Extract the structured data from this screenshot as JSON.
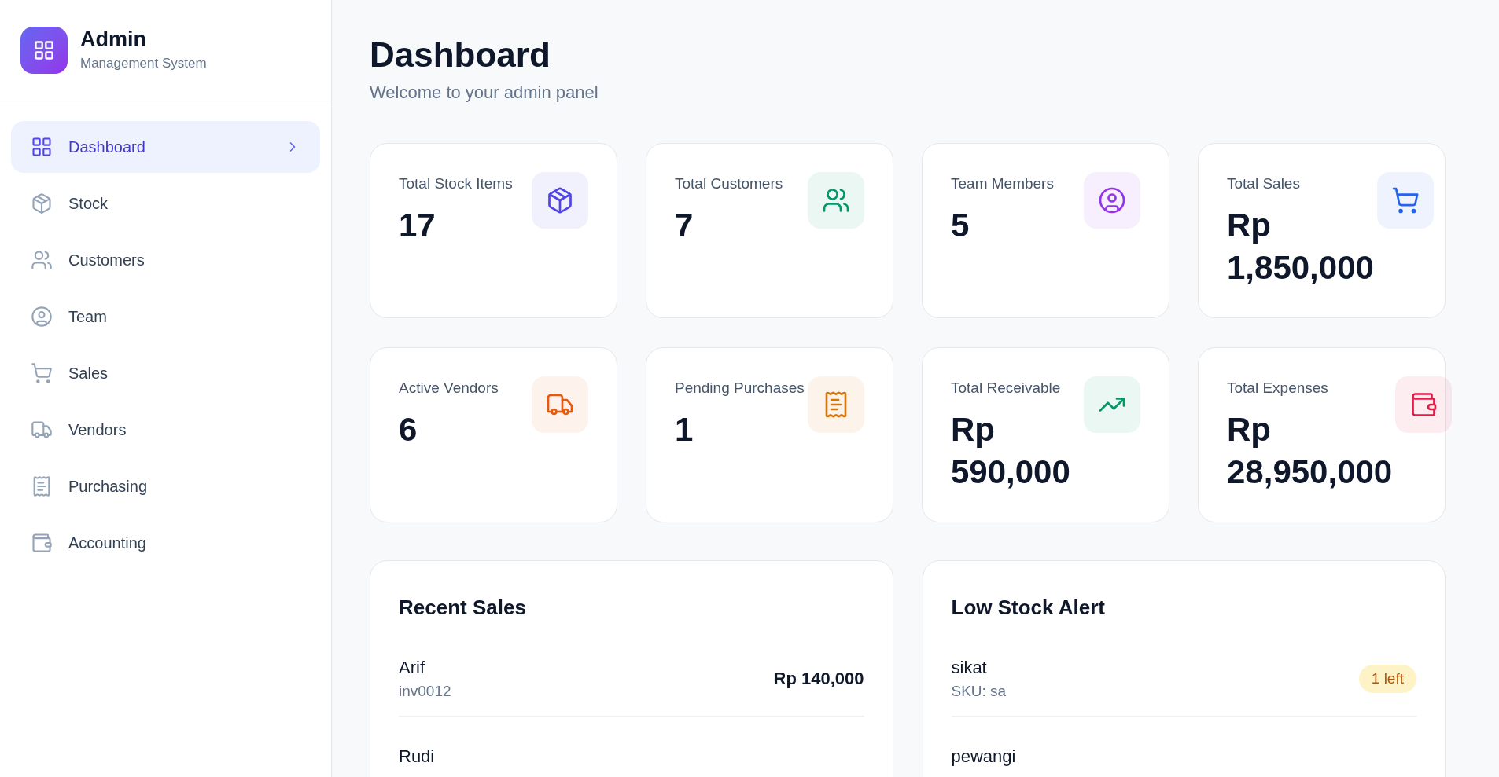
{
  "brand": {
    "title": "Admin",
    "subtitle": "Management System"
  },
  "nav": [
    {
      "label": "Dashboard",
      "kind": "grid",
      "selected": true
    },
    {
      "label": "Stock",
      "kind": "box",
      "selected": false
    },
    {
      "label": "Customers",
      "kind": "users",
      "selected": false
    },
    {
      "label": "Team",
      "kind": "person",
      "selected": false
    },
    {
      "label": "Sales",
      "kind": "cart",
      "selected": false
    },
    {
      "label": "Vendors",
      "kind": "truck",
      "selected": false
    },
    {
      "label": "Purchasing",
      "kind": "receipt",
      "selected": false
    },
    {
      "label": "Accounting",
      "kind": "wallet",
      "selected": false
    }
  ],
  "page": {
    "title": "Dashboard",
    "subtitle": "Welcome to your admin panel"
  },
  "stats": [
    {
      "label": "Total Stock Items",
      "value": "17",
      "kind": "box",
      "color": "#4f46e5"
    },
    {
      "label": "Total Customers",
      "value": "7",
      "kind": "users",
      "color": "#059669"
    },
    {
      "label": "Team Members",
      "value": "5",
      "kind": "person",
      "color": "#9333ea"
    },
    {
      "label": "Total Sales",
      "value": "Rp 1,850,000",
      "kind": "cart",
      "color": "#2563eb"
    },
    {
      "label": "Active Vendors",
      "value": "6",
      "kind": "truck",
      "color": "#ea580c"
    },
    {
      "label": "Pending Purchases",
      "value": "1",
      "kind": "receipt",
      "color": "#d97706"
    },
    {
      "label": "Total Receivable",
      "value": "Rp 590,000",
      "kind": "trend",
      "color": "#059669"
    },
    {
      "label": "Total Expenses",
      "value": "Rp 28,950,000",
      "kind": "wallet",
      "color": "#e11d48"
    }
  ],
  "recent_sales": {
    "title": "Recent Sales",
    "rows": [
      {
        "name": "Arif",
        "invoice": "inv0012",
        "amount": "Rp 140,000"
      },
      {
        "name": "Rudi"
      }
    ]
  },
  "low_stock": {
    "title": "Low Stock Alert",
    "rows": [
      {
        "name": "sikat",
        "sku": "SKU: sa",
        "badge": "1 left"
      },
      {
        "name": "pewangi"
      }
    ]
  }
}
